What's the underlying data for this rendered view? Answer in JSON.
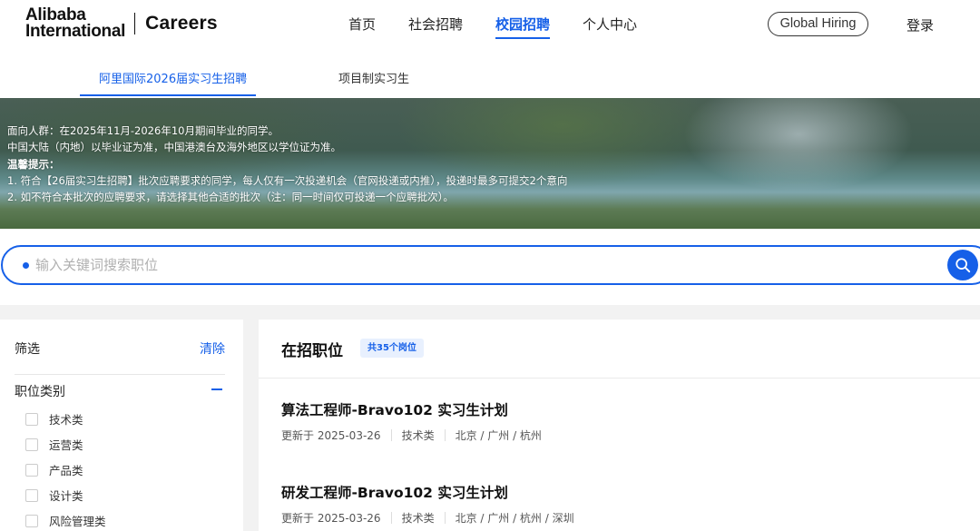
{
  "brand": {
    "line1": "Alibaba",
    "line2": "International",
    "product": "Careers"
  },
  "nav": [
    {
      "label": "首页",
      "active": false
    },
    {
      "label": "社会招聘",
      "active": false
    },
    {
      "label": "校园招聘",
      "active": true
    },
    {
      "label": "个人中心",
      "active": false
    }
  ],
  "global_hiring_label": "Global Hiring",
  "login_label": "登录",
  "subtabs": [
    {
      "label": "阿里国际2026届实习生招聘",
      "active": true
    },
    {
      "label": "项目制实习生",
      "active": false
    }
  ],
  "banner": {
    "lines": [
      "面向人群：在2025年11月-2026年10月期间毕业的同学。",
      "中国大陆（内地）以毕业证为准，中国港澳台及海外地区以学位证为准。",
      "温馨提示：",
      "1. 符合【26届实习生招聘】批次应聘要求的同学，每人仅有一次投递机会（官网投递或内推），投递时最多可提交2个意向",
      "2. 如不符合本批次的应聘要求，请选择其他合适的批次（注：同一时间仅可投递一个应聘批次）。"
    ]
  },
  "search": {
    "placeholder": "输入关键词搜索职位",
    "value": ""
  },
  "filter": {
    "title": "筛选",
    "clear_label": "清除",
    "category_title": "职位类别",
    "categories": [
      "技术类",
      "运营类",
      "产品类",
      "设计类",
      "风险管理类"
    ]
  },
  "jobs": {
    "title": "在招职位",
    "count_badge": "共35个岗位",
    "items": [
      {
        "title": "算法工程师-Bravo102 实习生计划",
        "updated": "更新于 2025-03-26",
        "category": "技术类",
        "locations": "北京 / 广州 / 杭州"
      },
      {
        "title": "研发工程师-Bravo102 实习生计划",
        "updated": "更新于 2025-03-26",
        "category": "技术类",
        "locations": "北京 / 广州 / 杭州 / 深圳"
      }
    ]
  },
  "colors": {
    "accent": "#1660e8",
    "text": "#111111",
    "muted": "#555555",
    "page_bg": "#f2f2f2"
  }
}
